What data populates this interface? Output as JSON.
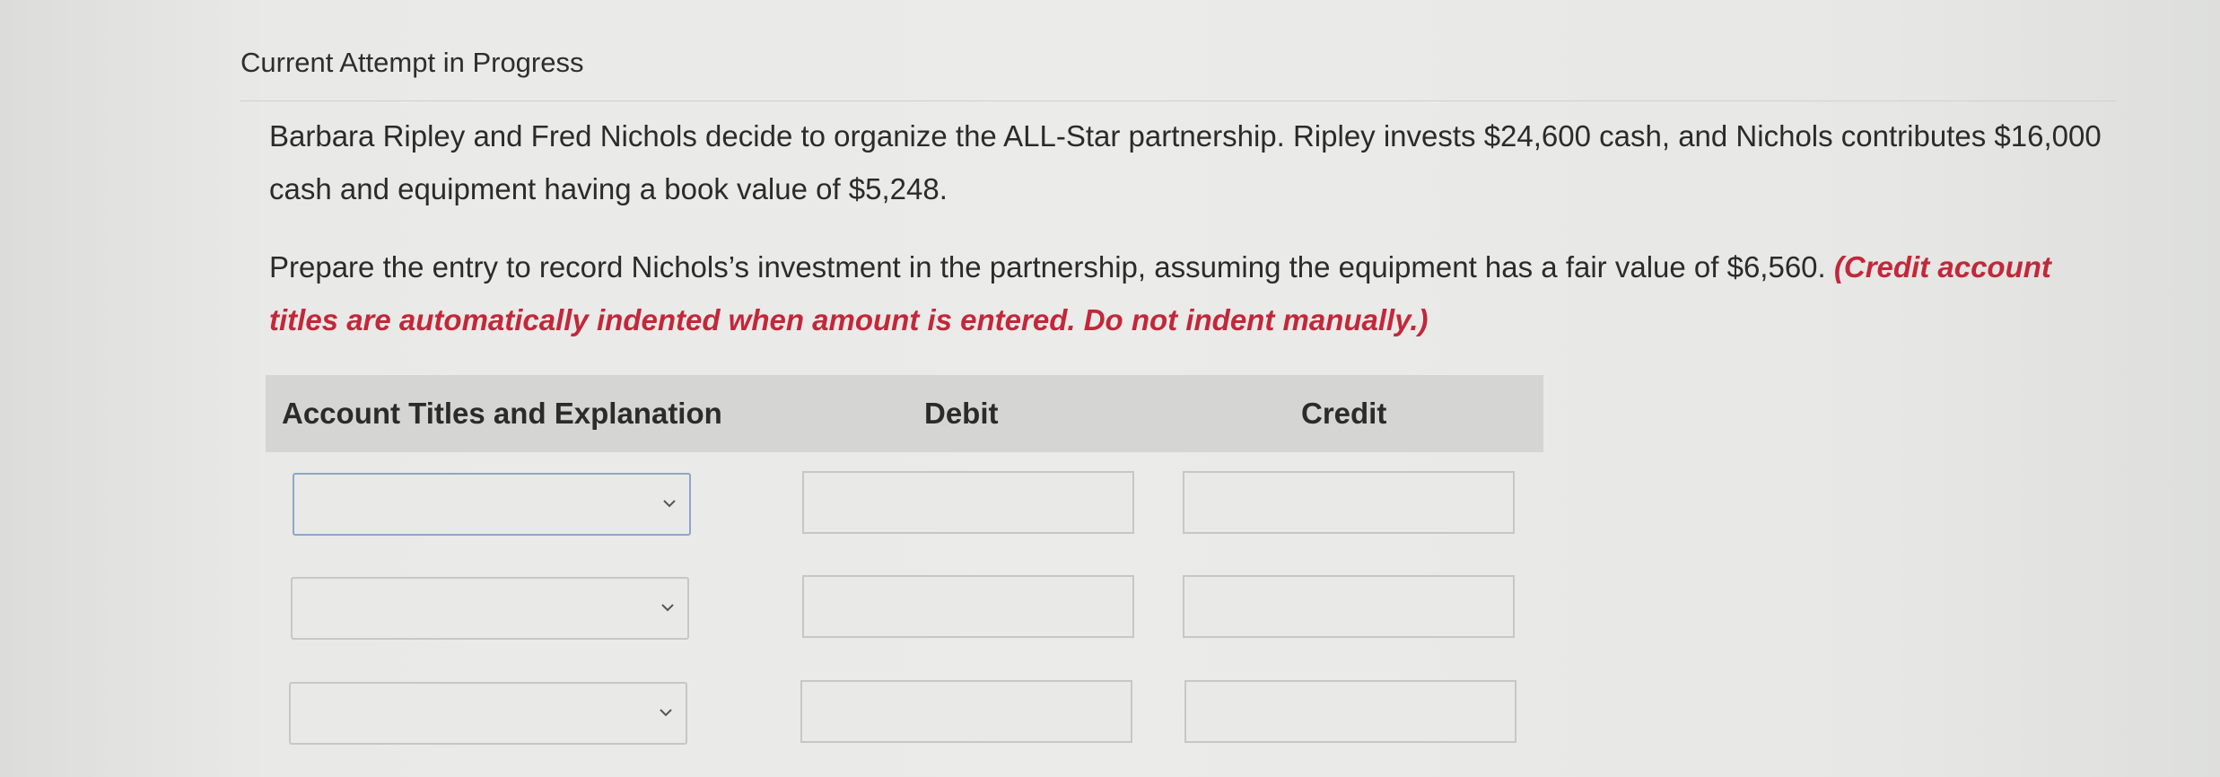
{
  "header": {
    "title": "Current Attempt in Progress"
  },
  "problem": {
    "paragraph1": "Barbara Ripley and Fred Nichols decide to organize the ALL-Star partnership. Ripley invests $24,600 cash, and Nichols contributes $16,000 cash and equipment having a book value of $5,248.",
    "paragraph2_text": "Prepare the entry to record Nichols’s investment in the partnership, assuming the equipment has a fair value of $6,560. ",
    "paragraph2_note": "(Credit account titles are automatically indented when amount is entered. Do not indent manually.)"
  },
  "journal_table": {
    "columns": {
      "account": "Account Titles and Explanation",
      "debit": "Debit",
      "credit": "Credit"
    },
    "rows": [
      {
        "account": "",
        "debit": "",
        "credit": ""
      },
      {
        "account": "",
        "debit": "",
        "credit": ""
      },
      {
        "account": "",
        "debit": "",
        "credit": ""
      }
    ]
  },
  "icons": {
    "dropdown": "chevron-down-icon"
  },
  "colors": {
    "note_red": "#c2283a",
    "header_bg": "#d5d5d3",
    "focus_border": "#8ea7c8"
  }
}
